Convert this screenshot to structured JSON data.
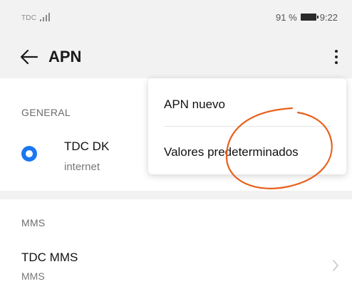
{
  "status_bar": {
    "carrier": "TDC",
    "battery": "91 %",
    "time": "9:22"
  },
  "toolbar": {
    "title": "APN"
  },
  "sections": {
    "general": {
      "header": "GENERAL",
      "apn_name": "TDC DK",
      "apn_type": "internet"
    },
    "mms": {
      "header": "MMS",
      "apn_name": "TDC MMS",
      "apn_type": "MMS"
    }
  },
  "menu": {
    "items": [
      "APN nuevo",
      "Valores predeterminados"
    ]
  },
  "colors": {
    "accent": "#1977f3",
    "annotation": "#e8601c"
  }
}
